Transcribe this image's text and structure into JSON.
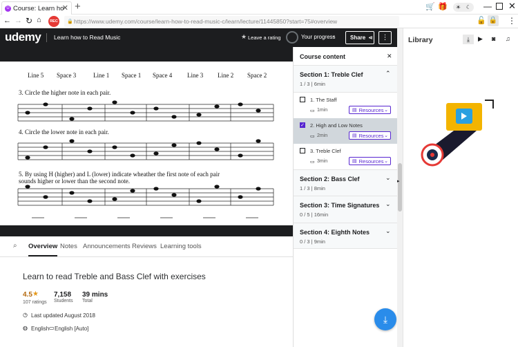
{
  "browser": {
    "tab_title": "Course: Learn how to",
    "url": "https://www.udemy.com/course/learn-how-to-read-music-c/learn/lecture/11445850?start=75#overview",
    "rec_label": "REC"
  },
  "header": {
    "logo": "udemy",
    "course_title": "Learn how to Read Music",
    "rating_link": "Leave a rating",
    "progress_label": "Your progress",
    "share_label": "Share"
  },
  "sheet": {
    "note_labels": [
      "Line 5",
      "Space 3",
      "Line 1",
      "Space 1",
      "Space 4",
      "Line 3",
      "Line 2",
      "Space 2"
    ],
    "q3": "3. Circle the higher note in each pair.",
    "q4": "4. Circle the lower note in each pair.",
    "q5_line1": "5. By using H (higher) and L (lower) indicate wheather the first note of each pair",
    "q5_line2": "sounds higher or lower than the second note."
  },
  "tabs": [
    "Overview",
    "Notes",
    "Announcements",
    "Reviews",
    "Learning tools"
  ],
  "overview": {
    "headline": "Learn to read Treble and Bass Clef with exercises",
    "rating": "4.5",
    "ratings_label": "107 ratings",
    "students": "7,158",
    "students_label": "Students",
    "total": "39 mins",
    "total_label": "Total",
    "updated": "Last updated August 2018",
    "language": "English",
    "captions": "English [Auto]"
  },
  "course_content": {
    "title": "Course content",
    "sections": [
      {
        "title": "Section 1: Treble Clef",
        "meta": "1 / 3 | 6min"
      },
      {
        "title": "Section 2: Bass Clef",
        "meta": "1 / 3 | 8min"
      },
      {
        "title": "Section 3: Time Signatures",
        "meta": "0 / 5 | 16min"
      },
      {
        "title": "Section 4: Eighth Notes",
        "meta": "0 / 3 | 9min"
      }
    ],
    "lectures": [
      {
        "title": "1. The Staff",
        "duration": "1min",
        "resources": "Resources",
        "done": false
      },
      {
        "title": "2. High and Low Notes",
        "duration": "2min",
        "resources": "Resources",
        "done": true
      },
      {
        "title": "3. Treble Clef",
        "duration": "3min",
        "resources": "Resources",
        "done": false
      }
    ]
  },
  "library": {
    "title": "Library"
  },
  "colors": {
    "accent": "#5624d0",
    "brand_red": "#d0021b",
    "download_blue": "#2a8cea",
    "active_row": "#d1d7dc"
  }
}
